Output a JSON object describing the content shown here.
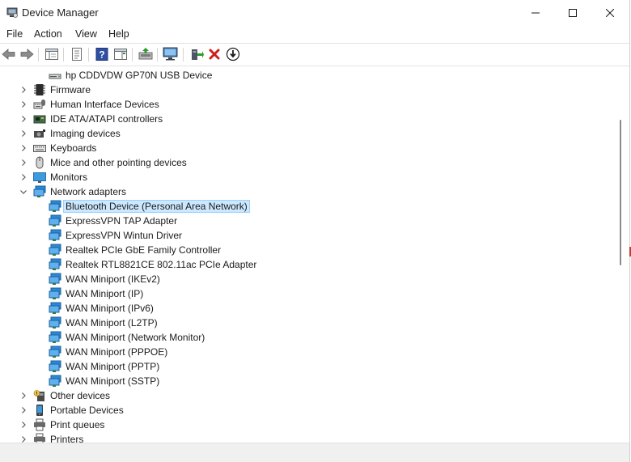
{
  "window": {
    "title": "Device Manager"
  },
  "menu": [
    "File",
    "Action",
    "View",
    "Help"
  ],
  "toolbar": {
    "buttons": [
      "back-icon",
      "forward-icon",
      "show-hide-icon",
      "properties-icon",
      "help-icon",
      "action-pane-icon",
      "update-driver-icon",
      "scan-hardware-icon",
      "enable-device-icon",
      "uninstall-icon",
      "download-icon"
    ]
  },
  "colors": {
    "selection_bg": "#cce8ff",
    "selection_border": "#99d1ff",
    "net_icon": "#2b88d8",
    "uninstall_red": "#d01c1c"
  },
  "tree": [
    {
      "label": "hp CDDVDW GP70N USB Device",
      "level": 1,
      "icon": "dvd-drive-icon"
    },
    {
      "label": "Firmware",
      "level": 0,
      "expander": "collapsed",
      "icon": "firmware-icon"
    },
    {
      "label": "Human Interface Devices",
      "level": 0,
      "expander": "collapsed",
      "icon": "hid-icon"
    },
    {
      "label": "IDE ATA/ATAPI controllers",
      "level": 0,
      "expander": "collapsed",
      "icon": "ide-controller-icon"
    },
    {
      "label": "Imaging devices",
      "level": 0,
      "expander": "collapsed",
      "icon": "camera-icon"
    },
    {
      "label": "Keyboards",
      "level": 0,
      "expander": "collapsed",
      "icon": "keyboard-icon"
    },
    {
      "label": "Mice and other pointing devices",
      "level": 0,
      "expander": "collapsed",
      "icon": "mouse-icon"
    },
    {
      "label": "Monitors",
      "level": 0,
      "expander": "collapsed",
      "icon": "monitor-icon"
    },
    {
      "label": "Network adapters",
      "level": 0,
      "expander": "expanded",
      "icon": "network-adapter-icon"
    },
    {
      "label": "Bluetooth Device (Personal Area Network)",
      "level": 1,
      "icon": "network-adapter-icon",
      "selected": true
    },
    {
      "label": "ExpressVPN TAP Adapter",
      "level": 1,
      "icon": "network-adapter-icon"
    },
    {
      "label": "ExpressVPN Wintun Driver",
      "level": 1,
      "icon": "network-adapter-icon"
    },
    {
      "label": "Realtek PCIe GbE Family Controller",
      "level": 1,
      "icon": "network-adapter-icon"
    },
    {
      "label": "Realtek RTL8821CE 802.11ac PCIe Adapter",
      "level": 1,
      "icon": "network-adapter-icon"
    },
    {
      "label": "WAN Miniport (IKEv2)",
      "level": 1,
      "icon": "network-adapter-icon"
    },
    {
      "label": "WAN Miniport (IP)",
      "level": 1,
      "icon": "network-adapter-icon"
    },
    {
      "label": "WAN Miniport (IPv6)",
      "level": 1,
      "icon": "network-adapter-icon"
    },
    {
      "label": "WAN Miniport (L2TP)",
      "level": 1,
      "icon": "network-adapter-icon"
    },
    {
      "label": "WAN Miniport (Network Monitor)",
      "level": 1,
      "icon": "network-adapter-icon"
    },
    {
      "label": "WAN Miniport (PPPOE)",
      "level": 1,
      "icon": "network-adapter-icon"
    },
    {
      "label": "WAN Miniport (PPTP)",
      "level": 1,
      "icon": "network-adapter-icon"
    },
    {
      "label": "WAN Miniport (SSTP)",
      "level": 1,
      "icon": "network-adapter-icon"
    },
    {
      "label": "Other devices",
      "level": 0,
      "expander": "collapsed",
      "icon": "unknown-device-icon"
    },
    {
      "label": "Portable Devices",
      "level": 0,
      "expander": "collapsed",
      "icon": "portable-device-icon"
    },
    {
      "label": "Print queues",
      "level": 0,
      "expander": "collapsed",
      "icon": "printer-icon"
    },
    {
      "label": "Printers",
      "level": 0,
      "expander": "collapsed",
      "icon": "printer-icon"
    }
  ]
}
